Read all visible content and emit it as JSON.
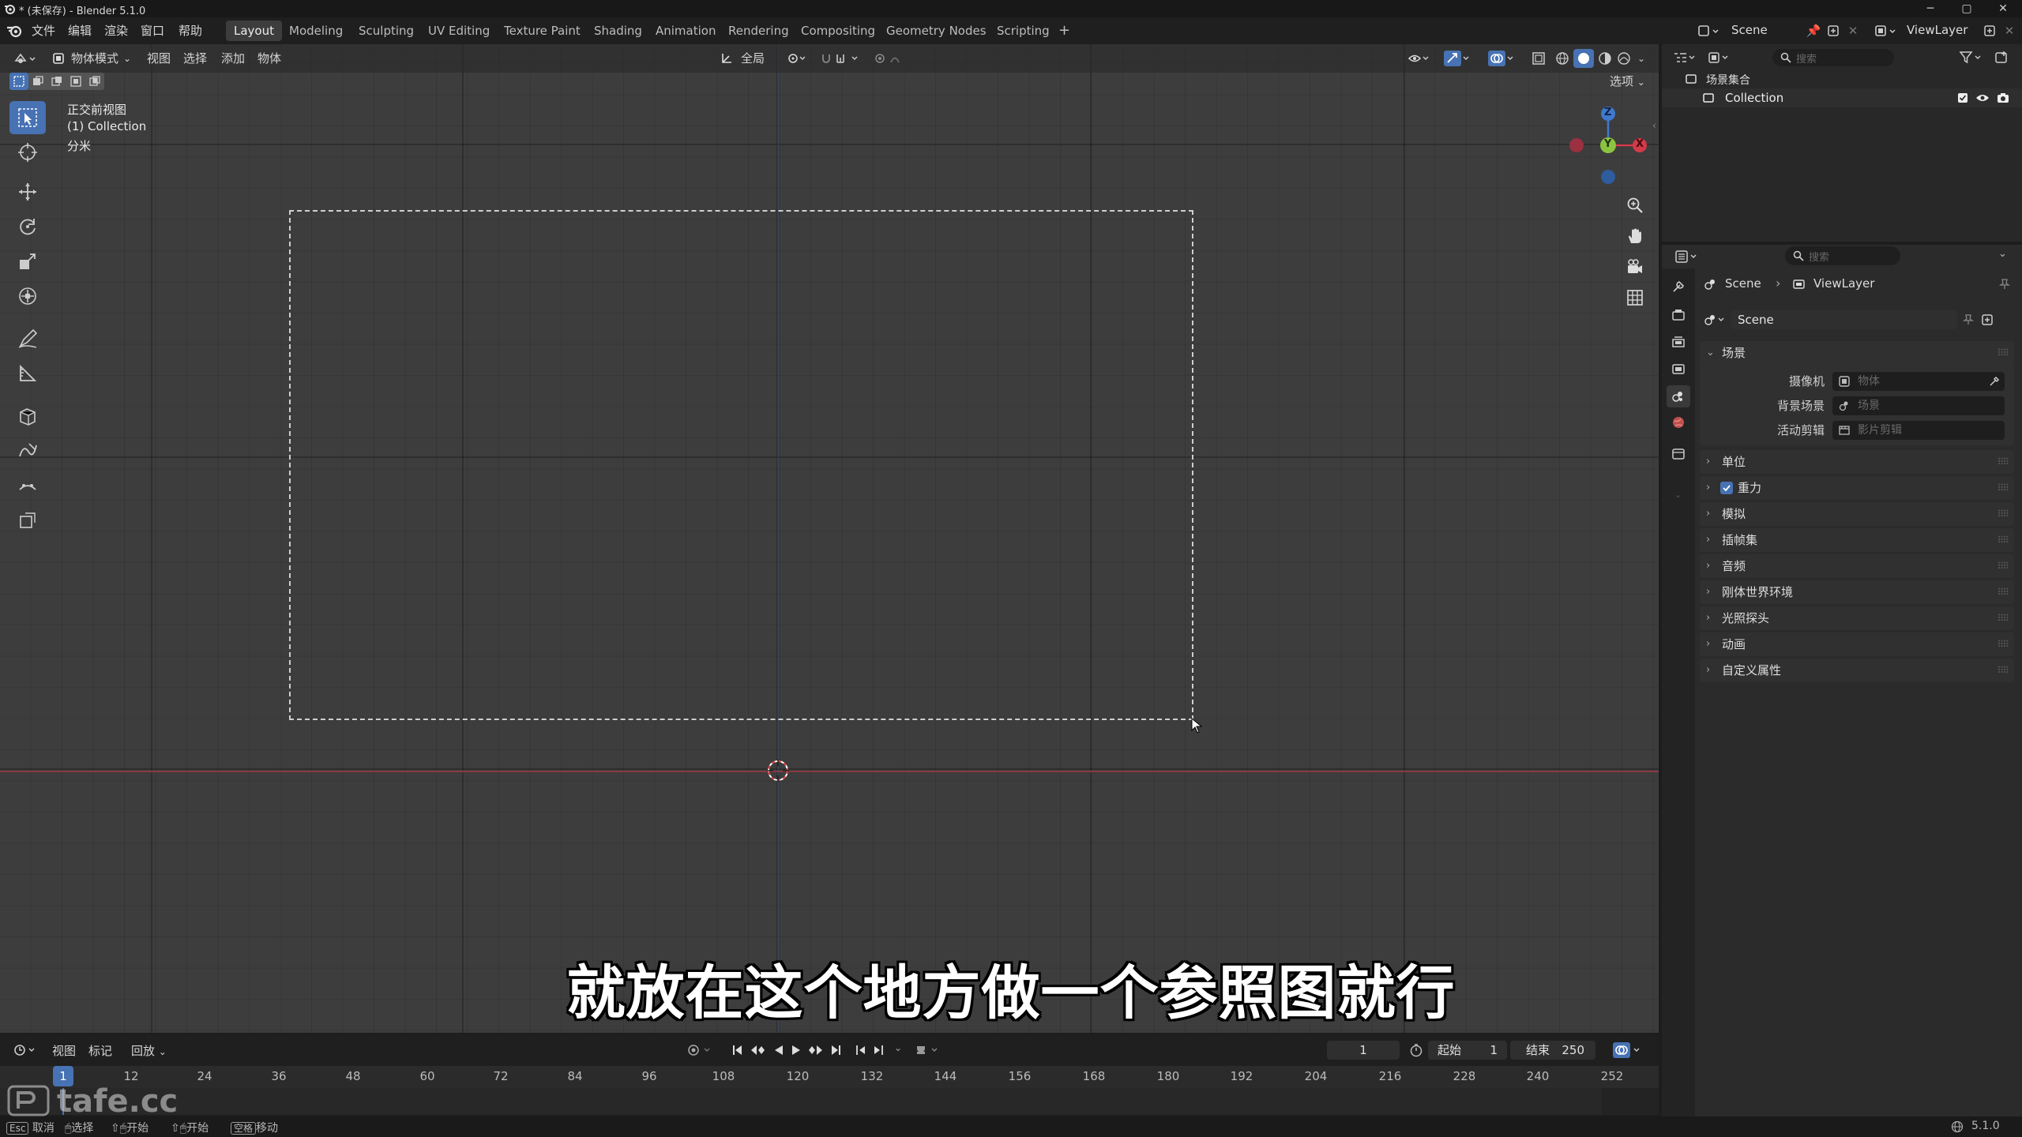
{
  "window": {
    "title": "* (未保存) - Blender 5.1.0"
  },
  "menu": {
    "items": [
      "文件",
      "编辑",
      "渲染",
      "窗口",
      "帮助"
    ]
  },
  "workspaces": [
    "Layout",
    "Modeling",
    "Sculpting",
    "UV Editing",
    "Texture Paint",
    "Shading",
    "Animation",
    "Rendering",
    "Compositing",
    "Geometry Nodes",
    "Scripting"
  ],
  "active_workspace": "Layout",
  "top_right": {
    "scene": "Scene",
    "view_layer": "ViewLayer"
  },
  "viewport_header": {
    "mode": "物体模式",
    "menus": [
      "视图",
      "选择",
      "添加",
      "物体"
    ],
    "transform_orientation": "全局",
    "options": "选项"
  },
  "viewport_overlay": {
    "view_name": "正交前视图",
    "collection": "(1) Collection",
    "unit": "分米"
  },
  "gizmo": {
    "z": "Z",
    "y": "Y",
    "x": "X"
  },
  "outliner": {
    "search_placeholder": "搜索",
    "root": "场景集合",
    "collection": "Collection"
  },
  "properties": {
    "search_placeholder": "搜索",
    "breadcrumb": [
      "Scene",
      "ViewLayer"
    ],
    "scene_name": "Scene",
    "scene_panel": {
      "title": "场景",
      "rows": [
        {
          "label": "摄像机",
          "placeholder": "物体"
        },
        {
          "label": "背景场景",
          "placeholder": "场景"
        },
        {
          "label": "活动剪辑",
          "placeholder": "影片剪辑"
        }
      ]
    },
    "sections": [
      "单位",
      "重力",
      "模拟",
      "插帧集",
      "音频",
      "刚体世界环境",
      "光照探头",
      "动画",
      "自定义属性"
    ],
    "gravity_checked": true
  },
  "timeline": {
    "menus": [
      "视图",
      "标记"
    ],
    "playback": "回放",
    "current_frame": "1",
    "start_label": "起始",
    "start": "1",
    "end_label": "结束",
    "end": "250",
    "ticks": [
      "1",
      "12",
      "24",
      "36",
      "48",
      "60",
      "72",
      "84",
      "96",
      "108",
      "120",
      "132",
      "144",
      "156",
      "168",
      "180",
      "192",
      "204",
      "216",
      "228",
      "240",
      "252"
    ]
  },
  "statusbar": {
    "items": [
      "取消",
      "选择",
      "开始",
      "开始",
      "移动"
    ],
    "keys": [
      "Esc",
      "",
      "",
      "",
      "空格"
    ],
    "version": "5.1.0"
  },
  "watermark": "tafe.cc",
  "subtitle": "就放在这个地方做一个参照图就行",
  "colors": {
    "accent": "#4772b3",
    "x_axis": "#d33a4a",
    "y_axis": "#8bc43f",
    "z_axis": "#3e79cf",
    "viewport_bg": "#3d3d3d"
  }
}
